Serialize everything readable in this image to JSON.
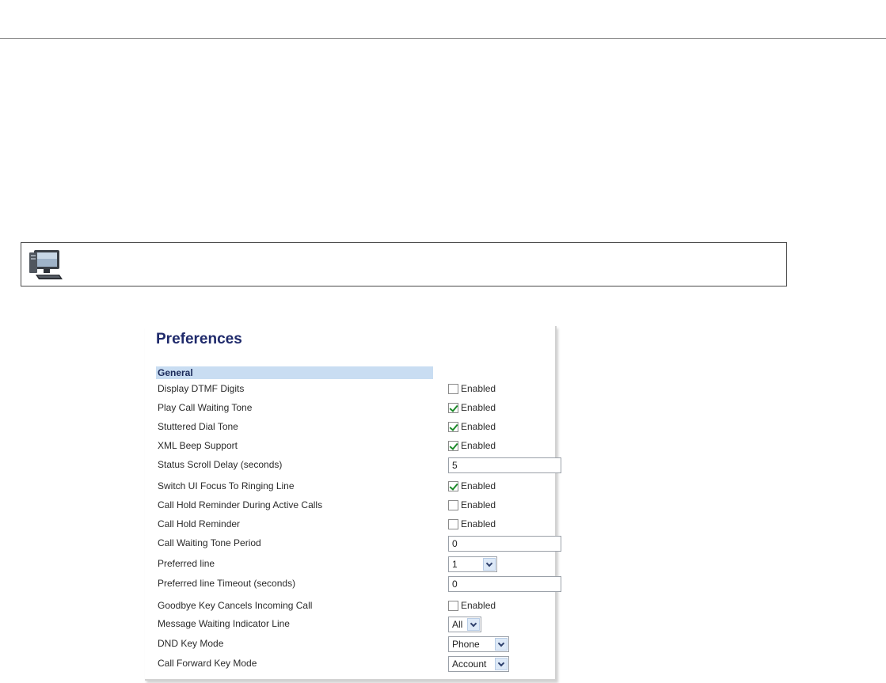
{
  "panel": {
    "title": "Preferences",
    "section": "General",
    "rows": [
      {
        "label": "Display DTMF Digits",
        "type": "checkbox",
        "checked": false,
        "text": "Enabled"
      },
      {
        "label": "Play Call Waiting Tone",
        "type": "checkbox",
        "checked": true,
        "text": "Enabled"
      },
      {
        "label": "Stuttered Dial Tone",
        "type": "checkbox",
        "checked": true,
        "text": "Enabled"
      },
      {
        "label": "XML Beep Support",
        "type": "checkbox",
        "checked": true,
        "text": "Enabled"
      },
      {
        "label": "Status Scroll Delay (seconds)",
        "type": "text",
        "value": "5"
      },
      {
        "label": "Switch UI Focus To Ringing Line",
        "type": "checkbox",
        "checked": true,
        "text": "Enabled"
      },
      {
        "label": "Call Hold Reminder During Active Calls",
        "type": "checkbox",
        "checked": false,
        "text": "Enabled"
      },
      {
        "label": "Call Hold Reminder",
        "type": "checkbox",
        "checked": false,
        "text": "Enabled"
      },
      {
        "label": "Call Waiting Tone Period",
        "type": "text",
        "value": "0"
      },
      {
        "label": "Preferred line",
        "type": "select",
        "value": "1"
      },
      {
        "label": "Preferred line Timeout (seconds)",
        "type": "text",
        "value": "0"
      },
      {
        "label": "Goodbye Key Cancels Incoming Call",
        "type": "checkbox",
        "checked": false,
        "text": "Enabled"
      },
      {
        "label": "Message Waiting Indicator Line",
        "type": "select",
        "value": "All"
      },
      {
        "label": "DND Key Mode",
        "type": "select",
        "value": "Phone"
      },
      {
        "label": "Call Forward Key Mode",
        "type": "select",
        "value": "Account"
      }
    ]
  },
  "note": {
    "icon": "computer-icon"
  }
}
